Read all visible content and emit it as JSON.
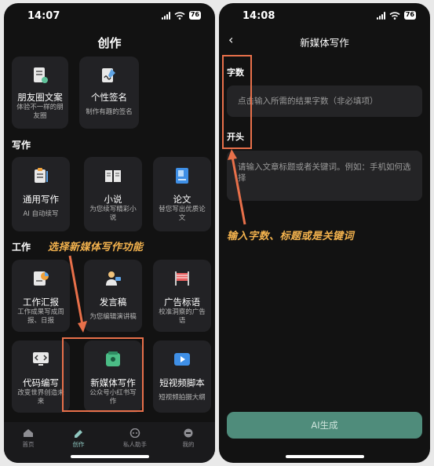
{
  "left": {
    "time": "14:07",
    "battery": "76",
    "title": "创作",
    "cards_top": [
      {
        "title": "朋友圈文案",
        "desc": "体验不一样的朋友圈"
      },
      {
        "title": "个性签名",
        "desc": "制作有趣的签名"
      }
    ],
    "section_writing": "写作",
    "cards_writing": [
      {
        "title": "通用写作",
        "desc": "AI 自动续写"
      },
      {
        "title": "小说",
        "desc": "为您续写精彩小说"
      },
      {
        "title": "论文",
        "desc": "替您写出优质论文"
      }
    ],
    "section_work": "工作",
    "cards_work": [
      {
        "title": "工作汇报",
        "desc": "工作成果写成周报、日报"
      },
      {
        "title": "发言稿",
        "desc": "为您编辑演讲稿"
      },
      {
        "title": "广告标语",
        "desc": "校准洞察的广告语"
      }
    ],
    "cards_bottom": [
      {
        "title": "代码编写",
        "desc": "改变世界创造未来"
      },
      {
        "title": "新媒体写作",
        "desc": "公众号小红书写作"
      },
      {
        "title": "短视频脚本",
        "desc": "短视频拍摄大纲"
      }
    ],
    "annotation": "选择新媒体写作功能",
    "tabs": [
      "首页",
      "创作",
      "私人助手",
      "我的"
    ]
  },
  "right": {
    "time": "14:08",
    "battery": "76",
    "title": "新媒体写作",
    "label_words": "字数",
    "field_words_placeholder": "点击输入所需的结果字数（非必填项）",
    "label_opening": "开头",
    "field_opening_placeholder": "请输入文章标题或者关键词。例如：手机如何选择",
    "annotation": "输入字数、标题或是关键词",
    "button": "AI生成"
  }
}
